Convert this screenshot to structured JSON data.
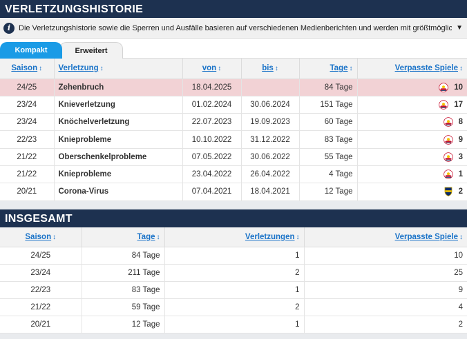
{
  "history": {
    "title": "Verletzungshistorie",
    "info_text": "Die Verletzungshistorie sowie die Sperren und Ausfälle basieren auf verschiedenen Medienberichten und werden mit größtmöglicher Sorgfalt",
    "tabs": [
      {
        "label": "Kompakt",
        "active": true
      },
      {
        "label": "Erweitert",
        "active": false
      }
    ],
    "columns": {
      "saison": "Saison",
      "verletzung": "Verletzung",
      "von": "von",
      "bis": "bis",
      "tage": "Tage",
      "spiele": "Verpasste Spiele"
    },
    "rows": [
      {
        "saison": "24/25",
        "verletzung": "Zehenbruch",
        "von": "18.04.2025",
        "bis": "",
        "tage": "84 Tage",
        "spiele": "10",
        "club": "redbull-icon",
        "highlight": true
      },
      {
        "saison": "23/24",
        "verletzung": "Knieverletzung",
        "von": "01.02.2024",
        "bis": "30.06.2024",
        "tage": "151 Tage",
        "spiele": "17",
        "club": "redbull-icon"
      },
      {
        "saison": "23/24",
        "verletzung": "Knöchelverletzung",
        "von": "22.07.2023",
        "bis": "19.09.2023",
        "tage": "60 Tage",
        "spiele": "8",
        "club": "redbull-icon"
      },
      {
        "saison": "22/23",
        "verletzung": "Knieprobleme",
        "von": "10.10.2022",
        "bis": "31.12.2022",
        "tage": "83 Tage",
        "spiele": "9",
        "club": "redbull-icon"
      },
      {
        "saison": "21/22",
        "verletzung": "Oberschenkelprobleme",
        "von": "07.05.2022",
        "bis": "30.06.2022",
        "tage": "55 Tage",
        "spiele": "3",
        "club": "redbull-icon"
      },
      {
        "saison": "21/22",
        "verletzung": "Knieprobleme",
        "von": "23.04.2022",
        "bis": "26.04.2022",
        "tage": "4 Tage",
        "spiele": "1",
        "club": "redbull-icon"
      },
      {
        "saison": "20/21",
        "verletzung": "Corona-Virus",
        "von": "07.04.2021",
        "bis": "18.04.2021",
        "tage": "12 Tage",
        "spiele": "2",
        "club": "boca-icon"
      }
    ]
  },
  "summary": {
    "title": "Insgesamt",
    "columns": {
      "saison": "Saison",
      "tage": "Tage",
      "verletzungen": "Verletzungen",
      "spiele": "Verpasste Spiele"
    },
    "rows": [
      {
        "saison": "24/25",
        "tage": "84 Tage",
        "verletzungen": "1",
        "spiele": "10"
      },
      {
        "saison": "23/24",
        "tage": "211 Tage",
        "verletzungen": "2",
        "spiele": "25"
      },
      {
        "saison": "22/23",
        "tage": "83 Tage",
        "verletzungen": "1",
        "spiele": "9"
      },
      {
        "saison": "21/22",
        "tage": "59 Tage",
        "verletzungen": "2",
        "spiele": "4"
      },
      {
        "saison": "20/21",
        "tage": "12 Tage",
        "verletzungen": "1",
        "spiele": "2"
      }
    ]
  },
  "colors": {
    "header_bg": "#1d3150",
    "link": "#1a73c8",
    "tab_active": "#1a9be6",
    "highlight_row": "#f2d2d5"
  },
  "sort_icon": "sort-arrows-icon"
}
